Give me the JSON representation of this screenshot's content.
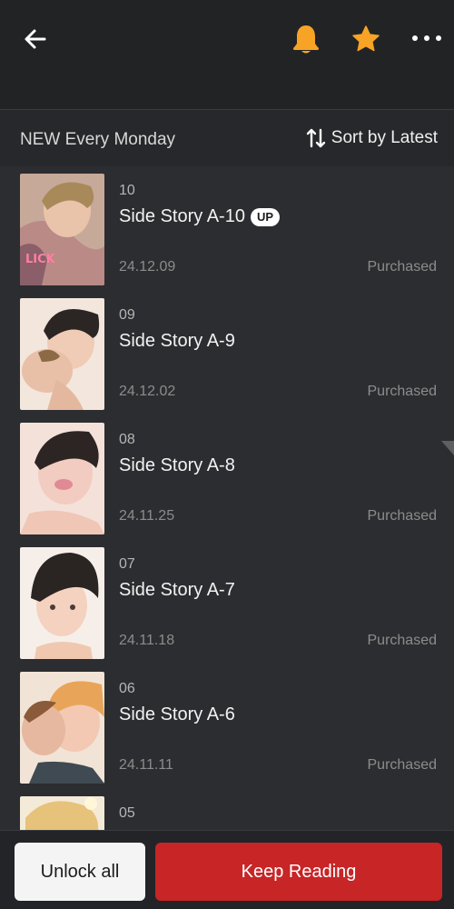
{
  "header": {
    "icons": [
      "back-arrow-icon",
      "bell-icon",
      "star-icon",
      "more-icon"
    ],
    "accent_color": "#f7a325"
  },
  "subheader": {
    "schedule": "NEW Every Monday",
    "sort_label": "Sort by Latest"
  },
  "episodes": [
    {
      "number": "10",
      "title": "Side Story A-10",
      "badge": "UP",
      "date": "24.12.09",
      "status": "Purchased"
    },
    {
      "number": "09",
      "title": "Side Story A-9",
      "badge": "",
      "date": "24.12.02",
      "status": "Purchased"
    },
    {
      "number": "08",
      "title": "Side Story A-8",
      "badge": "",
      "date": "24.11.25",
      "status": "Purchased"
    },
    {
      "number": "07",
      "title": "Side Story A-7",
      "badge": "",
      "date": "24.11.18",
      "status": "Purchased"
    },
    {
      "number": "06",
      "title": "Side Story A-6",
      "badge": "",
      "date": "24.11.11",
      "status": "Purchased"
    },
    {
      "number": "05",
      "title": "",
      "badge": "",
      "date": "",
      "status": ""
    }
  ],
  "bottom": {
    "unlock_label": "Unlock all",
    "keep_label": "Keep Reading",
    "keep_color": "#c72526"
  }
}
